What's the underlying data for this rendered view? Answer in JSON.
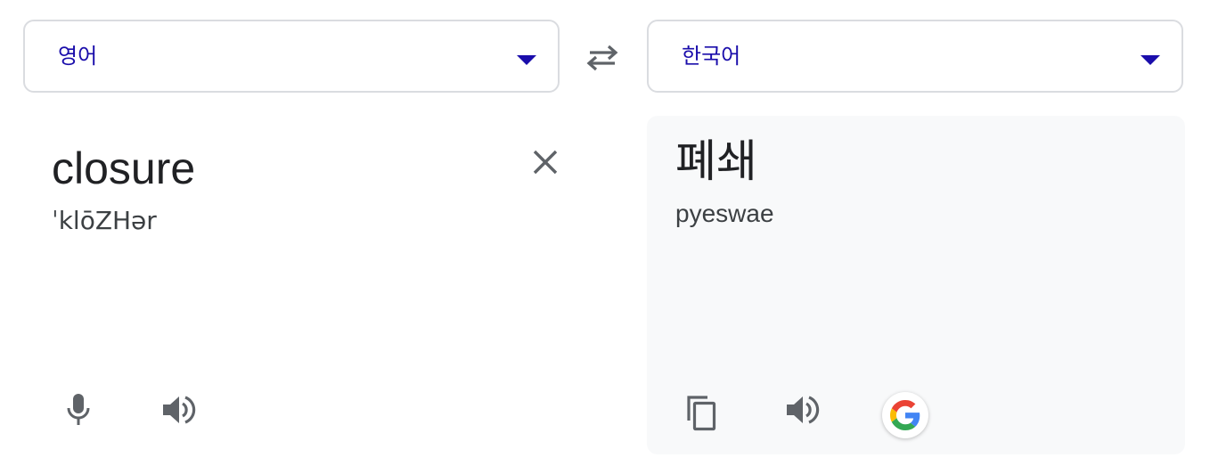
{
  "source_language": {
    "label": "영어"
  },
  "target_language": {
    "label": "한국어"
  },
  "source": {
    "text": "closure",
    "phonetic": "ˈklōZHər"
  },
  "target": {
    "text": "폐쇄",
    "romanization": "pyeswae"
  },
  "icons": {
    "swap": "swap-arrows-icon",
    "clear": "close-icon",
    "mic": "microphone-icon",
    "speaker": "speaker-icon",
    "copy": "copy-icon",
    "google": "google-logo-icon",
    "dropdown": "caret-down-icon"
  },
  "colors": {
    "accent": "#1a0dab",
    "icon": "#5f6368",
    "panel_bg": "#f8f9fa",
    "border": "#dadce0"
  }
}
